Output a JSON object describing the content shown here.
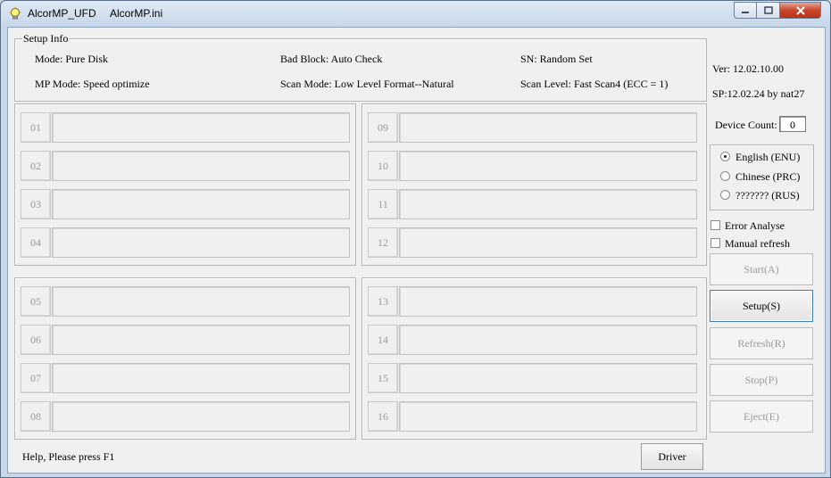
{
  "window": {
    "title_app": "AlcorMP_UFD",
    "title_file": "AlcorMP.ini"
  },
  "setup_info": {
    "caption": "Setup Info",
    "mode": "Mode: Pure Disk",
    "bad_block": "Bad Block: Auto Check",
    "sn": "SN: Random Set",
    "mp_mode": "MP Mode: Speed optimize",
    "scan_mode": "Scan Mode: Low Level Format--Natural",
    "scan_level": "Scan Level: Fast Scan4 (ECC = 1)"
  },
  "version": {
    "ver": "Ver: 12.02.10.00",
    "sp": "SP:12.02.24 by nat27"
  },
  "device_count": {
    "label": "Device Count:",
    "value": "0"
  },
  "language": {
    "options": [
      "English (ENU)",
      "Chinese (PRC)",
      "??????? (RUS)"
    ],
    "selected": "English (ENU)"
  },
  "checkboxes": {
    "error_analyse": "Error Analyse",
    "manual_refresh": "Manual refresh"
  },
  "buttons": {
    "start": "Start(A)",
    "setup": "Setup(S)",
    "refresh": "Refresh(R)",
    "stop": "Stop(P)",
    "eject": "Eject(E)",
    "driver": "Driver"
  },
  "slots": [
    "01",
    "02",
    "03",
    "04",
    "05",
    "06",
    "07",
    "08",
    "09",
    "10",
    "11",
    "12",
    "13",
    "14",
    "15",
    "16"
  ],
  "status_bar": {
    "help": "Help, Please press F1"
  }
}
